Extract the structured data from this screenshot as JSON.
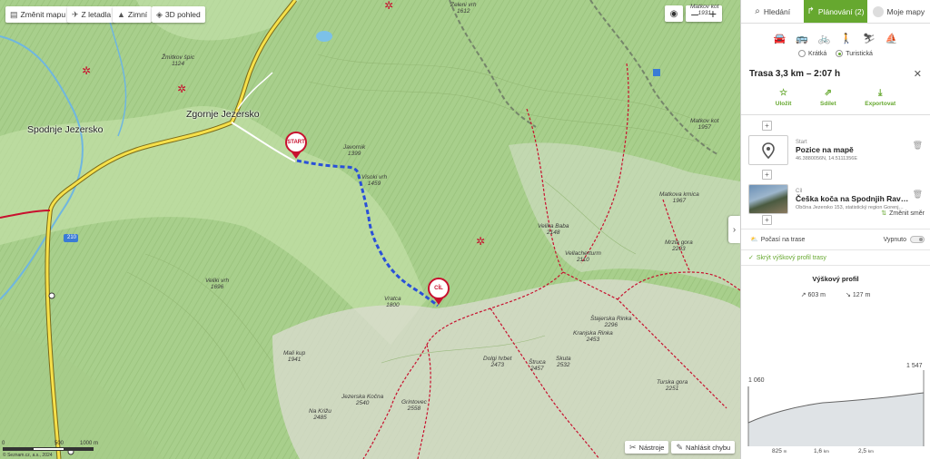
{
  "map": {
    "buttons": {
      "change_map": "Změnit mapu",
      "aerial": "Z letadla",
      "winter": "Zimní",
      "view_3d": "3D pohled"
    },
    "zoom_out": "–",
    "zoom_in": "+",
    "tools": "Nástroje",
    "report_error": "Nahlásit chybu",
    "towns": {
      "zgornje": "Zgornje Jezersko",
      "spodnje": "Spodnje Jezersko"
    },
    "peaks": [
      {
        "name": "Zeleni vrh",
        "elev": "1612"
      },
      {
        "name": "Žmitkov špic",
        "elev": "1124"
      },
      {
        "name": "Javornik",
        "elev": "1399"
      },
      {
        "name": "Visoki vrh",
        "elev": "1459"
      },
      {
        "name": "Veliki vrh",
        "elev": "1696"
      },
      {
        "name": "Velika Baba",
        "elev": "2148"
      },
      {
        "name": "Vellacherturm",
        "elev": "2110"
      },
      {
        "name": "Matkova krnica",
        "elev": "1967"
      },
      {
        "name": "Mrzla gora",
        "elev": "2203"
      },
      {
        "name": "Vratca",
        "elev": "1800"
      },
      {
        "name": "Mali kup",
        "elev": "1941"
      },
      {
        "name": "Dolgi hrbet",
        "elev": "2473"
      },
      {
        "name": "Štruca",
        "elev": "2457"
      },
      {
        "name": "Skuta",
        "elev": "2532"
      },
      {
        "name": "Kranjska Rinka",
        "elev": "2453"
      },
      {
        "name": "Štajerska Rinka",
        "elev": "2296"
      },
      {
        "name": "Turska gora",
        "elev": "2251"
      },
      {
        "name": "Jezerska Kočna",
        "elev": "2540"
      },
      {
        "name": "Grintovec",
        "elev": "2558"
      },
      {
        "name": "Na Križu",
        "elev": "2485"
      },
      {
        "name": "Matkov kot",
        "elev": "1931"
      },
      {
        "name": "Matkov kot",
        "elev": "1957"
      }
    ],
    "road_number": "210",
    "start_pin": "START",
    "end_pin": "CÍL",
    "scale": {
      "left": "0",
      "mid": "500",
      "right": "1000 m"
    },
    "copyright": "© Seznam.cz, a.s., 2024"
  },
  "panel": {
    "tabs": [
      {
        "label": "Hledání"
      },
      {
        "label": "Plánování (2)"
      },
      {
        "label": "Moje mapy"
      }
    ],
    "route_options": {
      "shortest": "Krátká",
      "tourist": "Turistická"
    },
    "route_title": "Trasa 3,3 km – 2:07 h",
    "actions": {
      "save": "Uložit",
      "share": "Sdílet",
      "export": "Exportovat"
    },
    "start": {
      "label": "Start",
      "name": "Pozice na mapě",
      "coords": "46.3880056N, 14.5111356E"
    },
    "end": {
      "label": "Cíl",
      "name": "Češka koča na Spodnjih Rav…",
      "sub": "Občina Jezersko 153, statistický region Gorenj…"
    },
    "change_direction": "Změnit směr",
    "weather": {
      "label": "Počasí na trase",
      "state": "Vypnuto"
    },
    "hide_profile": "Skrýt výškový profil trasy",
    "profile": {
      "title": "Výškový profil",
      "up": "603 m",
      "down": "127 m",
      "min_label": "1 060",
      "max_label": "1 547",
      "x_labels": [
        {
          "value": "825",
          "unit": "m"
        },
        {
          "value": "1,6",
          "unit": "km"
        },
        {
          "value": "2,5",
          "unit": "km"
        }
      ]
    }
  }
}
